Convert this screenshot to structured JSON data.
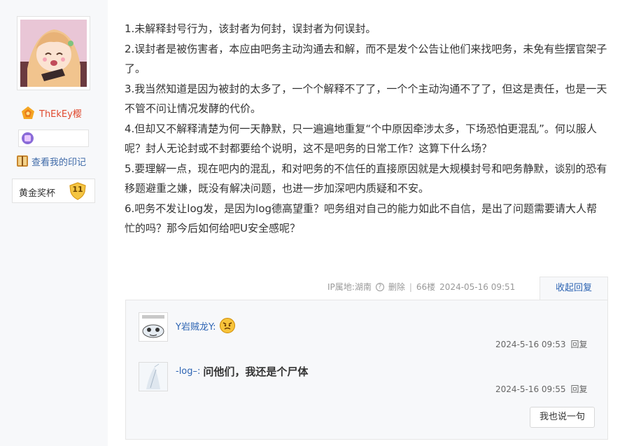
{
  "user": {
    "name": "ThEkEy樱",
    "marks_link": "查看我的印记",
    "award_label": "黄金奖杯",
    "award_count": "11"
  },
  "post": {
    "paragraphs": [
      "1.未解释封号行为，该封者为何封，误封者为何误封。",
      "2.误封者是被伤害者，本应由吧务主动沟通去和解，而不是发个公告让他们来找吧务，未免有些摆官架子了。",
      "3.我当然知道是因为被封的太多了，一个个解释不了了，一个个主动沟通不了了，但这是责任，也是一天不管不问让情况发酵的代价。",
      "4.但却又不解释清楚为何一天静默，只一遍遍地重复“个中原因牵涉太多，下场恐怕更混乱”。何以服人呢？封人无论封或不封都要给个说明，这不是吧务的日常工作？这算下什么场？",
      "5.要理解一点，现在吧内的混乱，和对吧务的不信任的直接原因就是大规模封号和吧务静默，谈别的恐有移题避重之嫌，既没有解决问题，也进一步加深吧内质疑和不安。",
      "6.吧务不发让log发，是因为log德高望重？吧务组对自己的能力如此不自信，是出了问题需要请大人帮忙的吗？那今后如何给吧U安全感呢？"
    ]
  },
  "meta": {
    "ip": "IP属地:湖南",
    "help_glyph": "?",
    "delete": "删除",
    "separator": "|",
    "floor": "66楼",
    "time": "2024-05-16 09:51",
    "collapse": "收起回复"
  },
  "replies": [
    {
      "user": "Y岩贼龙Y:",
      "text": "",
      "emoji": "angry-emoji",
      "time": "2024-5-16 09:53",
      "reply": "回复"
    },
    {
      "user": "-log–:",
      "text": "问他们，我还是个尸体",
      "time": "2024-5-16 09:55",
      "reply": "回复"
    }
  ],
  "say_button": "我也说一句",
  "colors": {
    "link": "#2d64b3",
    "username": "#e04a2f",
    "sidebar_bg": "#f7f8fa",
    "reply_bg": "#f7f8fa"
  }
}
